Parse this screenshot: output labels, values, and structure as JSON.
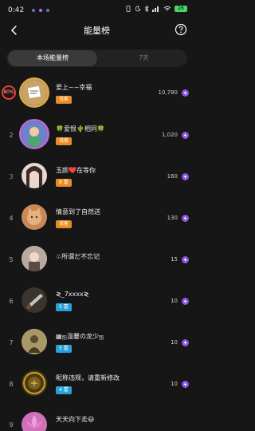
{
  "status": {
    "time": "0:42",
    "battery": "26"
  },
  "header": {
    "title": "能量榜"
  },
  "tabs": [
    {
      "label": "本场能量榜"
    },
    {
      "label": "7天"
    }
  ],
  "colors": {
    "accent_purple": "#8a55e0",
    "badge_orange": "#e98c22",
    "badge_blue": "#2aa0d8",
    "rank1_ring": "#e0433d"
  },
  "rows": [
    {
      "rank": "",
      "ring_label": "80%",
      "name": "爱上~~幸福",
      "badge": "说客",
      "badge_color": "orange",
      "score": "10,780"
    },
    {
      "rank": "2",
      "name": "🍀爱恨🌵相同🍀",
      "badge": "说客",
      "badge_color": "orange",
      "score": "1,020"
    },
    {
      "rank": "3",
      "name": "玉颜❤️在等你",
      "badge": "8 富",
      "badge_color": "orange",
      "score": "160"
    },
    {
      "rank": "4",
      "name": "情意到了自然送",
      "badge": "说客",
      "badge_color": "orange",
      "score": "130"
    },
    {
      "rank": "5",
      "name": "♧所谓だ不忘记",
      "badge": "",
      "badge_color": "",
      "score": "15"
    },
    {
      "rank": "6",
      "name": "≷_7xxxx≷",
      "badge": "5 富",
      "badge_color": "blue",
      "score": "10"
    },
    {
      "rank": "7",
      "name": "▦ஐ温馨の龙少ஐ",
      "badge": "5 富",
      "badge_color": "blue",
      "score": "10"
    },
    {
      "rank": "8",
      "name": "昵称违规，请重新修改",
      "badge": "4 富",
      "badge_color": "blue",
      "score": "10"
    },
    {
      "rank": "9",
      "name": "天天向下走😃",
      "badge": "",
      "badge_color": "",
      "score": ""
    }
  ]
}
